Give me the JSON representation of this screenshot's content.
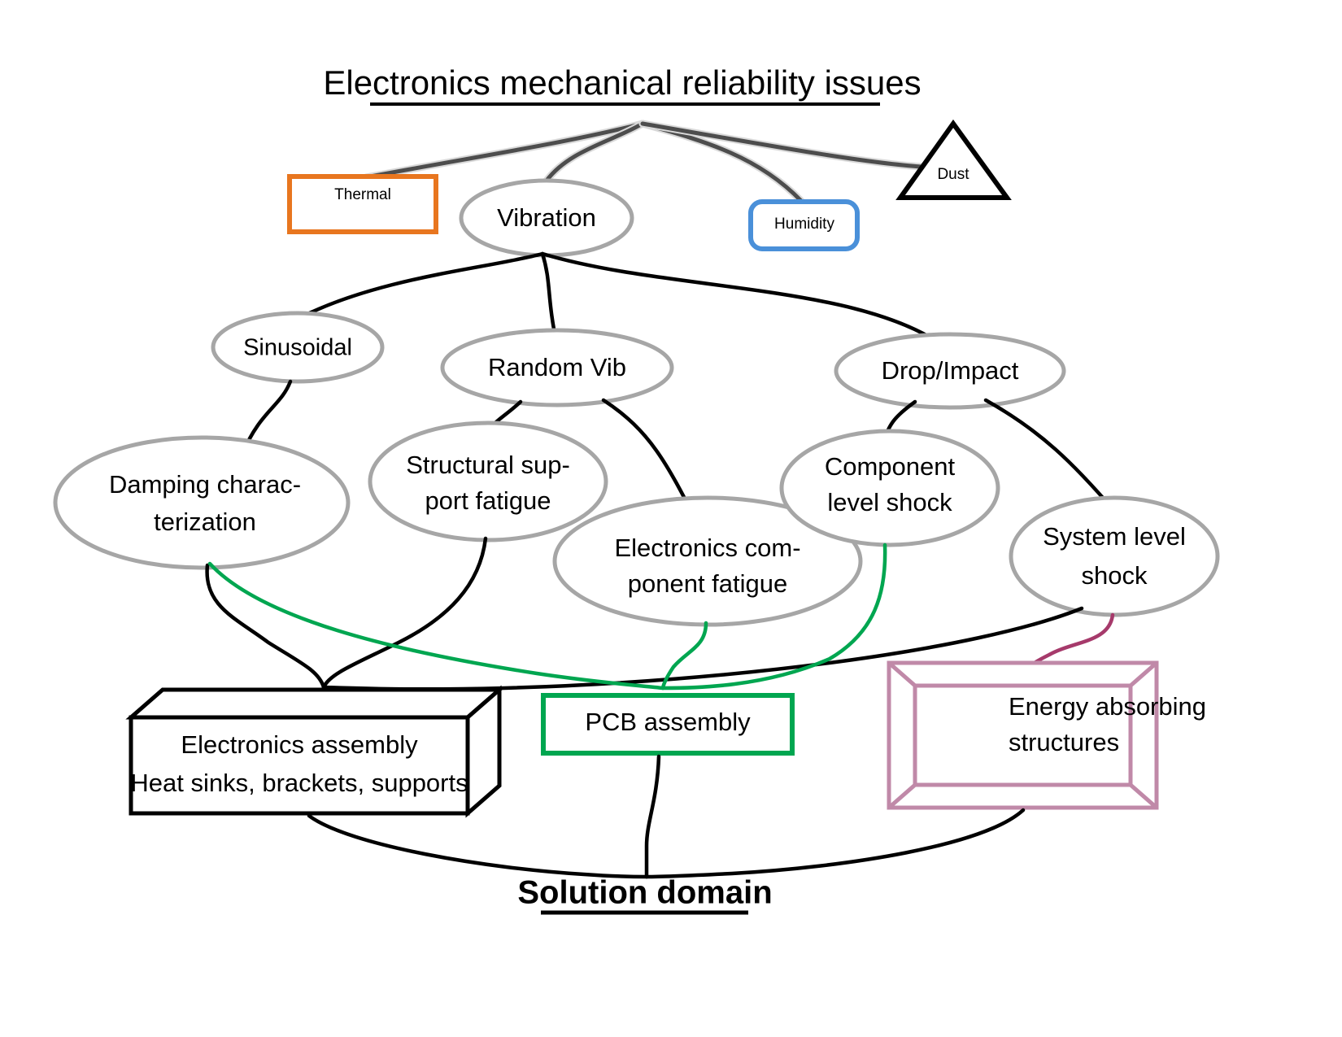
{
  "diagram": {
    "title": "Electronics mechanical reliability issues",
    "footer": "Solution domain",
    "root_label": "Electronics mechanical reliability issues",
    "colors": {
      "ellipse_stroke": "#a6a6a6",
      "thermal_border": "#e8761f",
      "humidity_border": "#4a90d9",
      "dust_border": "#000000",
      "pcb_border": "#00a650",
      "energy_border": "#c089a8",
      "link_black": "#000000",
      "link_green": "#00a650",
      "link_magenta": "#a63a6b",
      "link_gray": "#4d4d4d"
    },
    "level1": [
      {
        "id": "thermal",
        "label": "Thermal",
        "shape": "rectangle"
      },
      {
        "id": "vibration",
        "label": "Vibration",
        "shape": "ellipse"
      },
      {
        "id": "humidity",
        "label": "Humidity",
        "shape": "rounded-rectangle"
      },
      {
        "id": "dust",
        "label": "Dust",
        "shape": "triangle"
      }
    ],
    "level2": [
      {
        "id": "sinusoidal",
        "label": "Sinusoidal",
        "shape": "ellipse"
      },
      {
        "id": "random-vib",
        "label": "Random Vib",
        "shape": "ellipse"
      },
      {
        "id": "drop-impact",
        "label": "Drop/Impact",
        "shape": "ellipse"
      }
    ],
    "level3": [
      {
        "id": "damping",
        "label_line1": "Damping charac-",
        "label_line2": "terization",
        "shape": "ellipse"
      },
      {
        "id": "structural-support-fatigue",
        "label_line1": "Structural sup-",
        "label_line2": "port fatigue",
        "shape": "ellipse"
      },
      {
        "id": "electronics-component-fatigue",
        "label_line1": "Electronics com-",
        "label_line2": "ponent fatigue",
        "shape": "ellipse"
      },
      {
        "id": "component-level-shock",
        "label_line1": "Component",
        "label_line2": "level shock",
        "shape": "ellipse"
      },
      {
        "id": "system-level-shock",
        "label_line1": "System level",
        "label_line2": "shock",
        "shape": "ellipse"
      }
    ],
    "solutions": [
      {
        "id": "electronics-assembly",
        "label_line1": "Electronics assembly",
        "label_line2": "Heat sinks, brackets, supports",
        "shape": "cube"
      },
      {
        "id": "pcb-assembly",
        "label_line1": "PCB assembly",
        "label_line2": "",
        "shape": "rectangle"
      },
      {
        "id": "energy-absorbing-structures",
        "label_line1": "Energy absorbing",
        "label_line2": "structures",
        "shape": "frame"
      }
    ]
  }
}
